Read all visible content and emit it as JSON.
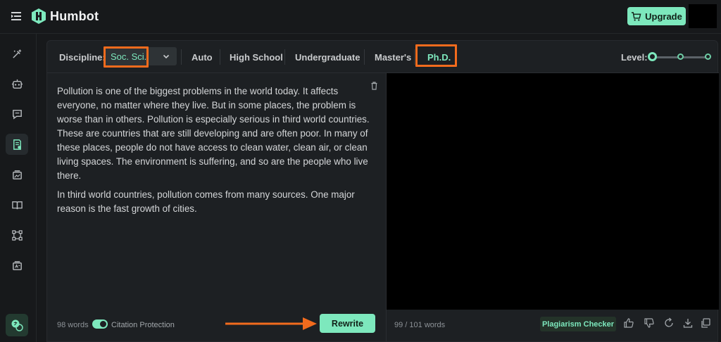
{
  "header": {
    "brand": "Humbot",
    "upgrade_label": "Upgrade"
  },
  "toolbar": {
    "discipline_label": "Discipline:",
    "discipline_value": "Soc. Sci.",
    "tabs": [
      {
        "label": "Auto"
      },
      {
        "label": "High School"
      },
      {
        "label": "Undergraduate"
      },
      {
        "label": "Master's"
      },
      {
        "label": "Ph.D."
      }
    ],
    "active_tab": "Ph.D.",
    "level_label": "Level:",
    "level_steps": 3,
    "level_selected": 1
  },
  "input": {
    "paragraphs": [
      "Pollution is one of the biggest problems in the world today. It affects everyone, no matter where they live. But in some places, the problem is worse than in others. Pollution is especially serious in third world countries. These are countries that are still developing and are often poor. In many of these places, people do not have access to clean water, clean air, or clean living spaces. The environment is suffering, and so are the people who live there.",
      "In third world countries, pollution comes from many sources. One major reason is the fast growth of cities."
    ],
    "word_count": "98 words",
    "citation_label": "Citation Protection",
    "citation_on": true,
    "rewrite_label": "Rewrite"
  },
  "output": {
    "word_count": "99 / 101 words",
    "plagiarism_label": "Plagiarism Checker"
  },
  "colors": {
    "accent": "#7de8bd",
    "highlight": "#f26b1d",
    "background": "#17191b",
    "panel": "#1d2023"
  }
}
